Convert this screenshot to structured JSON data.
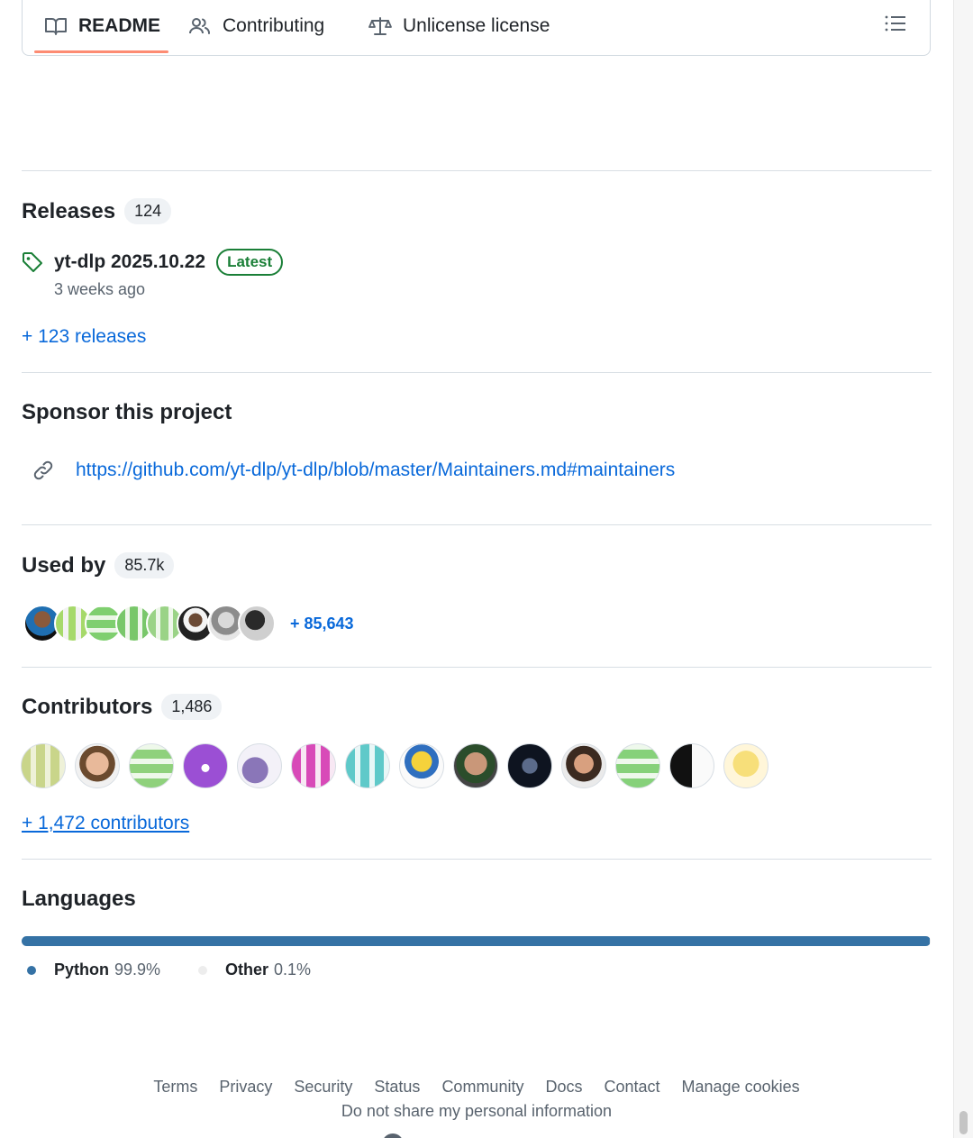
{
  "tabs": [
    {
      "label": "README",
      "icon": "book-icon",
      "active": true
    },
    {
      "label": "Contributing",
      "icon": "people-icon",
      "active": false
    },
    {
      "label": "Unlicense license",
      "icon": "law-icon",
      "active": false
    }
  ],
  "releases": {
    "title": "Releases",
    "count": "124",
    "latest_name": "yt-dlp 2025.10.22",
    "latest_badge": "Latest",
    "latest_time": "3 weeks ago",
    "more_label": "+ 123 releases"
  },
  "sponsor": {
    "title": "Sponsor this project",
    "url": "https://github.com/yt-dlp/yt-dlp/blob/master/Maintainers.md#maintainers"
  },
  "used_by": {
    "title": "Used by",
    "count": "85.7k",
    "more_label": "+ 85,643"
  },
  "contributors": {
    "title": "Contributors",
    "count": "1,486",
    "more_label": "+ 1,472 contributors"
  },
  "languages": {
    "title": "Languages",
    "items": [
      {
        "name": "Python",
        "percent": "99.9%",
        "color": "#3572A5",
        "share": 99.9
      },
      {
        "name": "Other",
        "percent": "0.1%",
        "color": "#ededed",
        "share": 0.1
      }
    ]
  },
  "footer": {
    "links": [
      "Terms",
      "Privacy",
      "Security",
      "Status",
      "Community",
      "Docs",
      "Contact",
      "Manage cookies"
    ],
    "sub": "Do not share my personal information"
  },
  "colors": {
    "accent_link": "#0969da",
    "tab_underline": "#fd8c73",
    "latest_badge": "#1a7f37"
  }
}
